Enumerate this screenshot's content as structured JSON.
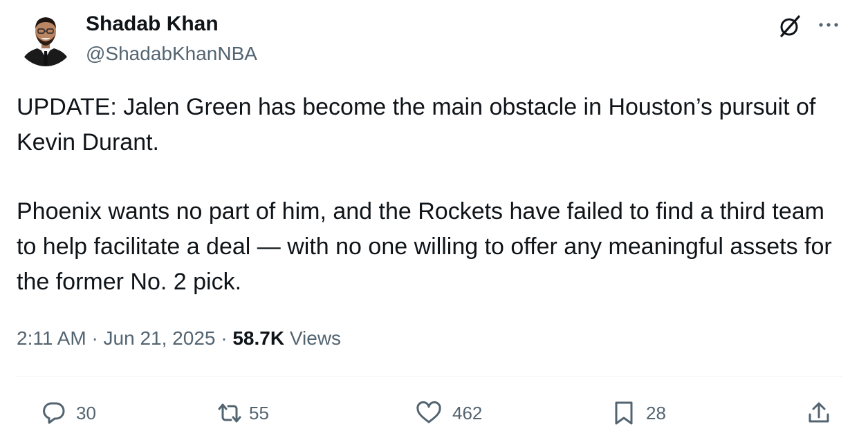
{
  "author": {
    "display_name": "Shadab Khan",
    "handle": "@ShadabKhanNBA"
  },
  "tweet": {
    "paragraphs": [
      "UPDATE: Jalen Green has become the main obstacle in Houston’s pursuit of Kevin Durant.",
      "Phoenix wants no part of him, and the Rockets have failed to find a third team to help facilitate a deal — with no one willing to offer any meaningful assets for the former No. 2 pick."
    ]
  },
  "meta": {
    "time": "2:11 AM",
    "separator": "·",
    "date": "Jun 21, 2025",
    "views_count": "58.7K",
    "views_label": "Views"
  },
  "actions": {
    "replies": "30",
    "reposts": "55",
    "likes": "462",
    "bookmarks": "28"
  },
  "icons": {
    "header": [
      "grok-icon",
      "more-icon"
    ],
    "actions": [
      "reply-icon",
      "repost-icon",
      "like-icon",
      "bookmark-icon",
      "share-icon"
    ]
  },
  "colors": {
    "text_primary": "#0f1419",
    "text_secondary": "#536471",
    "divider": "#eff3f4"
  }
}
